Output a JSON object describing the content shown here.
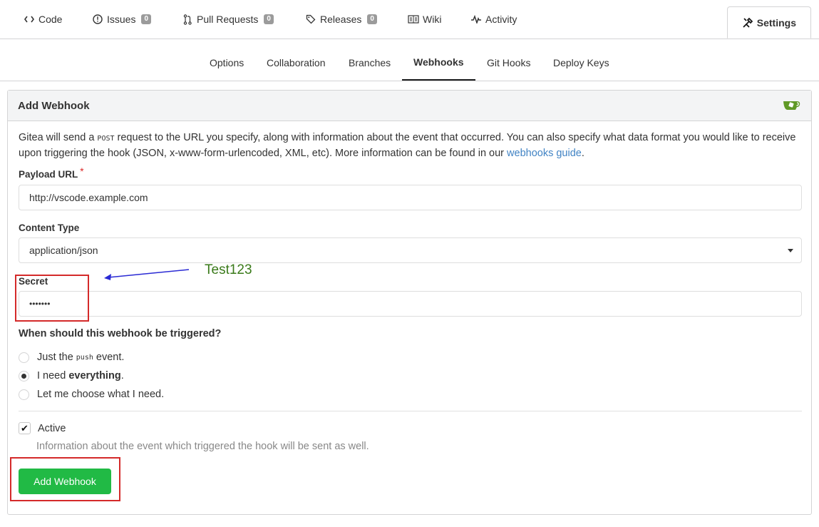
{
  "tabs": [
    {
      "label": "Code",
      "icon": "code-icon"
    },
    {
      "label": "Issues",
      "icon": "issue-icon",
      "count": "0"
    },
    {
      "label": "Pull Requests",
      "icon": "pull-request-icon",
      "count": "0"
    },
    {
      "label": "Releases",
      "icon": "tag-icon",
      "count": "0"
    },
    {
      "label": "Wiki",
      "icon": "book-icon"
    },
    {
      "label": "Activity",
      "icon": "pulse-icon"
    },
    {
      "label": "Settings",
      "icon": "tools-icon",
      "active": true
    }
  ],
  "subtabs": [
    {
      "label": "Options"
    },
    {
      "label": "Collaboration"
    },
    {
      "label": "Branches"
    },
    {
      "label": "Webhooks",
      "active": true
    },
    {
      "label": "Git Hooks"
    },
    {
      "label": "Deploy Keys"
    }
  ],
  "panel": {
    "title": "Add Webhook",
    "logo_icon": "gitea-logo-icon",
    "desc_pre": "Gitea will send a ",
    "desc_code": "POST",
    "desc_mid": " request to the URL you specify, along with information about the event that occurred. You can also specify what data format you would like to receive upon triggering the hook (JSON, x-www-form-urlencoded, XML, etc). More information can be found in our ",
    "desc_link": "webhooks guide",
    "desc_end": "."
  },
  "form": {
    "payload_label": "Payload URL",
    "required_mark": "*",
    "payload_value": "http://vscode.example.com",
    "content_type_label": "Content Type",
    "content_type_value": "application/json",
    "secret_label": "Secret",
    "secret_value": "•••••••",
    "trigger_question": "When should this webhook be triggered?",
    "radio1_pre": "Just the",
    "radio1_code": "push",
    "radio1_post": "event.",
    "radio2_pre": "I need ",
    "radio2_bold": "everything",
    "radio2_post": ".",
    "radio3": "Let me choose what I need.",
    "selected_option": "everything",
    "active_label": "Active",
    "active_checked": true,
    "active_help": "Information about the event which triggered the hook will be sent as well.",
    "submit_label": "Add Webhook"
  },
  "annotation": {
    "note": "Test123",
    "note_color": "#3a7a1a",
    "box_color": "#d42a2a",
    "arrow_color": "#2a2ad4"
  },
  "colors": {
    "primary_button": "#21ba45",
    "link": "#4183c4",
    "required": "#db2828"
  }
}
